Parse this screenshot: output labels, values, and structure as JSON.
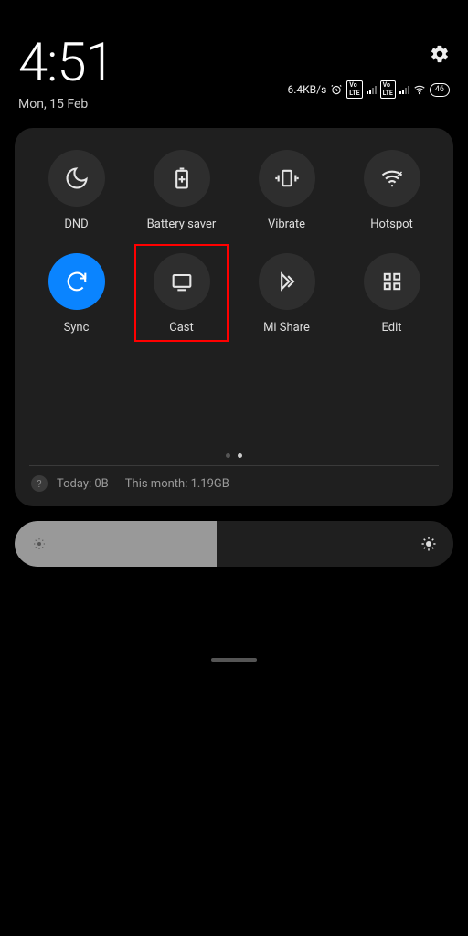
{
  "header": {
    "time": "4:51",
    "date": "Mon, 15 Feb"
  },
  "status": {
    "speed": "6.4KB/s",
    "battery": "46"
  },
  "tiles": [
    {
      "label": "DND"
    },
    {
      "label": "Battery saver"
    },
    {
      "label": "Vibrate"
    },
    {
      "label": "Hotspot"
    },
    {
      "label": "Sync"
    },
    {
      "label": "Cast"
    },
    {
      "label": "Mi Share"
    },
    {
      "label": "Edit"
    }
  ],
  "usage": {
    "today_label": "Today: 0B",
    "month_label": "This month: 1.19GB"
  }
}
